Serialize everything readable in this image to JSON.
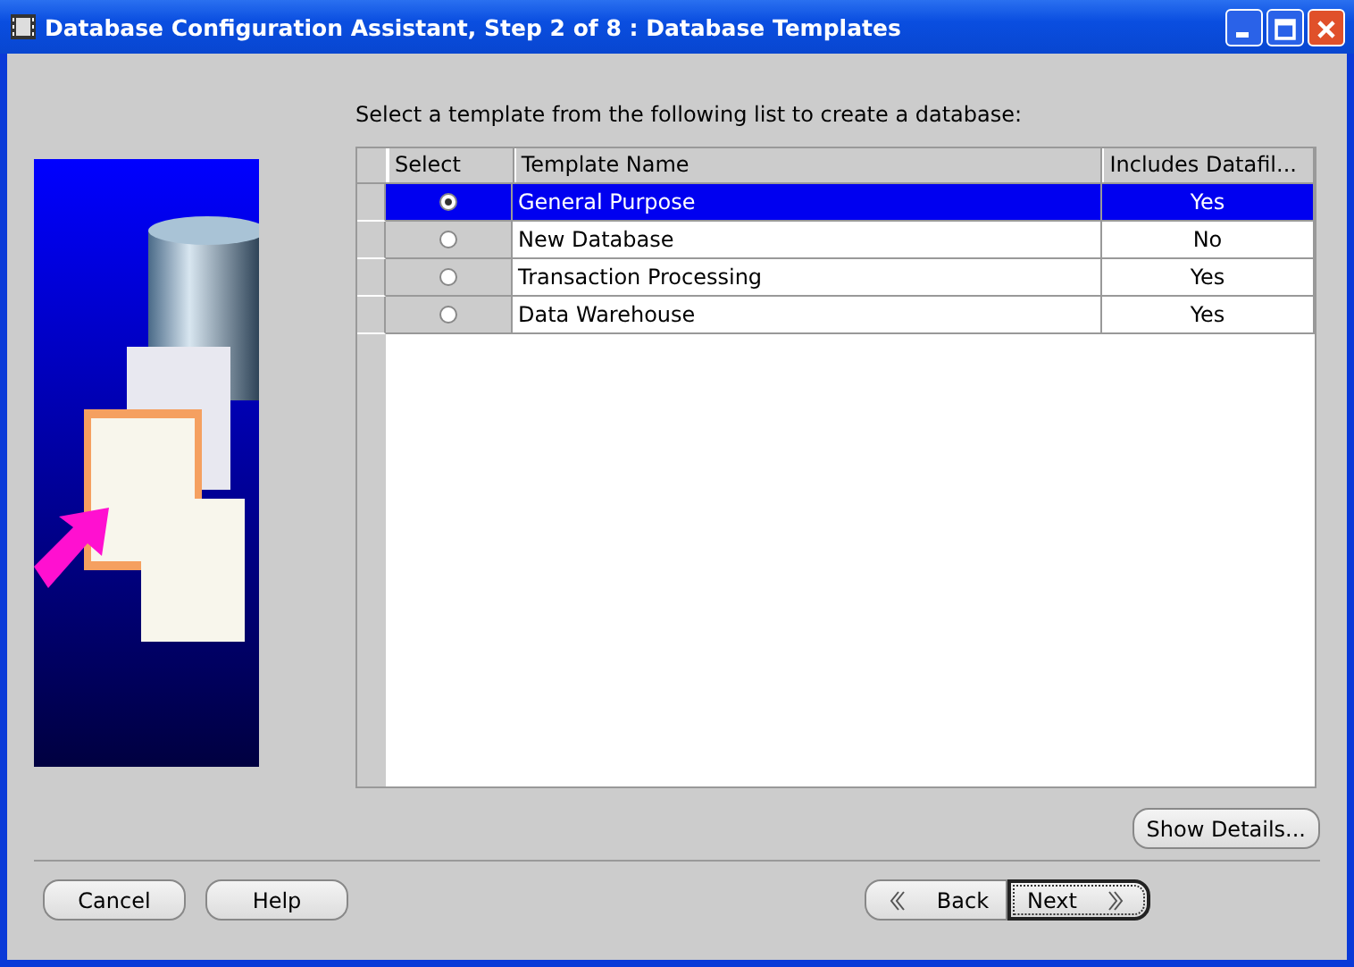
{
  "window": {
    "title": "Database Configuration Assistant, Step 2 of 8 : Database Templates"
  },
  "instruction": "Select a template from the following list to create a database:",
  "table": {
    "columns": [
      "Select",
      "Template Name",
      "Includes Datafil..."
    ],
    "rows": [
      {
        "selected": true,
        "template_name": "General Purpose",
        "includes_datafiles": "Yes"
      },
      {
        "selected": false,
        "template_name": "New Database",
        "includes_datafiles": "No"
      },
      {
        "selected": false,
        "template_name": "Transaction Processing",
        "includes_datafiles": "Yes"
      },
      {
        "selected": false,
        "template_name": "Data Warehouse",
        "includes_datafiles": "Yes"
      }
    ]
  },
  "details_button": "Show Details...",
  "left_buttons": [
    "Cancel",
    "Help"
  ],
  "nav_buttons": [
    {
      "label": "Back",
      "kind": "back",
      "focused": false
    },
    {
      "label": "Next",
      "kind": "next",
      "focused": true
    }
  ]
}
